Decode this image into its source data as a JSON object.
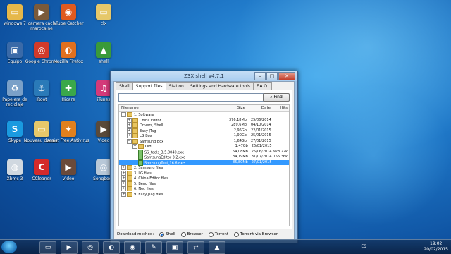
{
  "desktop_icons": [
    {
      "label": "windows 7",
      "icon": "folder-icon",
      "color": "#e6b84a"
    },
    {
      "label": "camera cach marocaine",
      "icon": "video-thumb-icon",
      "color": "#7a5a3a"
    },
    {
      "label": "aTube Catcher",
      "icon": "atube-icon",
      "color": "#e05a1e"
    },
    {
      "label": "clx",
      "icon": "folder-icon",
      "color": "#e6c86a"
    },
    {
      "label": "Equipo",
      "icon": "computer-icon",
      "color": "#3a6aa8"
    },
    {
      "label": "Google Chrome",
      "icon": "chrome-icon",
      "color": "#d23a2a"
    },
    {
      "label": "Mozilla Firefox",
      "icon": "firefox-icon",
      "color": "#e0701e"
    },
    {
      "label": "shell",
      "icon": "shell-icon",
      "color": "#3a9a3a"
    },
    {
      "label": "Papelera de reciclaje",
      "icon": "recycle-bin-icon",
      "color": "#7aa0c8"
    },
    {
      "label": "iRoot",
      "icon": "anchor-icon",
      "color": "#2a7ab8"
    },
    {
      "label": "Hicare",
      "icon": "hicare-icon",
      "color": "#3aa84a"
    },
    {
      "label": "iTunes",
      "icon": "itunes-icon",
      "color": "#d43a7a"
    },
    {
      "label": "Skype",
      "icon": "skype-icon",
      "color": "#1a9ae0"
    },
    {
      "label": "Nouveau dossier",
      "icon": "folder-icon",
      "color": "#e6c86a"
    },
    {
      "label": "Avast Free Antivirus",
      "icon": "avast-icon",
      "color": "#e0801e"
    },
    {
      "label": "Video",
      "icon": "video-thumb-icon",
      "color": "#5a4a3a"
    },
    {
      "label": "Xbmc 3",
      "icon": "media-icon",
      "color": "#d0d8e0"
    },
    {
      "label": "CCleaner",
      "icon": "ccleaner-icon",
      "color": "#d42a2a"
    },
    {
      "label": "Video",
      "icon": "video-thumb-icon",
      "color": "#6a4a3a"
    },
    {
      "label": "Songbook",
      "icon": "disc-icon",
      "color": "#b8c8d8"
    }
  ],
  "window": {
    "title": "Z3X shell v4.7.1",
    "tabs": [
      "Shell",
      "Support files",
      "Station",
      "Settings and Hardware tools",
      "F.A.Q."
    ],
    "active_tab": "Support files",
    "search_placeholder": "",
    "find_label": "Find",
    "columns": {
      "filename": "Filename",
      "size": "Size",
      "date": "Date",
      "hits": "Hits"
    },
    "rows": [
      {
        "indent": 0,
        "exp": "−",
        "type": "folder",
        "name": "1. Software",
        "size": "",
        "date": "",
        "hits": ""
      },
      {
        "indent": 1,
        "exp": "+",
        "type": "folder",
        "name": "China Editor",
        "size": "376,18Mb",
        "date": "25/06/2014",
        "hits": ""
      },
      {
        "indent": 1,
        "exp": "+",
        "type": "folder",
        "name": "Drivers, Shell",
        "size": "289,6Mb",
        "date": "04/10/2014",
        "hits": ""
      },
      {
        "indent": 1,
        "exp": "+",
        "type": "folder",
        "name": "Easy JTag",
        "size": "2,95Gb",
        "date": "22/01/2015",
        "hits": ""
      },
      {
        "indent": 1,
        "exp": "+",
        "type": "folder",
        "name": "LG Box",
        "size": "1,90Gb",
        "date": "25/01/2015",
        "hits": ""
      },
      {
        "indent": 1,
        "exp": "−",
        "type": "folder",
        "name": "Samsung Box",
        "size": "1,64Gb",
        "date": "27/01/2015",
        "hits": ""
      },
      {
        "indent": 2,
        "exp": "+",
        "type": "folder",
        "name": "Old",
        "size": "1,47Gb",
        "date": "26/01/2015",
        "hits": ""
      },
      {
        "indent": 2,
        "exp": "",
        "type": "file",
        "name": "SS_tools_3.5.0040.exe",
        "size": "54,08Mb",
        "date": "25/06/2014",
        "hits": "928.22k"
      },
      {
        "indent": 2,
        "exp": "",
        "type": "file",
        "name": "SamsungEditor 3.2.exe",
        "size": "34,19Mb",
        "date": "31/07/2014",
        "hits": "155.36k"
      },
      {
        "indent": 2,
        "exp": "",
        "type": "file",
        "name": "SamsungTool_16.6.exe",
        "size": "85,80Mb",
        "date": "27/01/2015",
        "hits": "",
        "selected": true
      },
      {
        "indent": 0,
        "exp": "+",
        "type": "folder",
        "name": "2. Samsung files",
        "size": "",
        "date": "",
        "hits": ""
      },
      {
        "indent": 0,
        "exp": "+",
        "type": "folder",
        "name": "3. LG files",
        "size": "",
        "date": "",
        "hits": ""
      },
      {
        "indent": 0,
        "exp": "+",
        "type": "folder",
        "name": "4. China Editor files",
        "size": "",
        "date": "",
        "hits": ""
      },
      {
        "indent": 0,
        "exp": "+",
        "type": "folder",
        "name": "5. Benq files",
        "size": "",
        "date": "",
        "hits": ""
      },
      {
        "indent": 0,
        "exp": "+",
        "type": "folder",
        "name": "6. Nec files",
        "size": "",
        "date": "",
        "hits": ""
      },
      {
        "indent": 0,
        "exp": "+",
        "type": "folder",
        "name": "9. Easy JTag files",
        "size": "",
        "date": "",
        "hits": ""
      }
    ],
    "download_method_label": "Download method:",
    "download_options": [
      "Shell",
      "Browser",
      "Torrent",
      "Torrent via Browser"
    ],
    "download_selected": "Shell"
  },
  "taskbar": {
    "items": [
      "explorer-icon",
      "media-player-icon",
      "chrome-icon",
      "firefox-icon",
      "atube-icon",
      "tool-icon",
      "folder-icon",
      "teamviewer-icon",
      "shell-icon"
    ],
    "language": "ES",
    "time": "19:02",
    "date": "20/02/2015"
  }
}
